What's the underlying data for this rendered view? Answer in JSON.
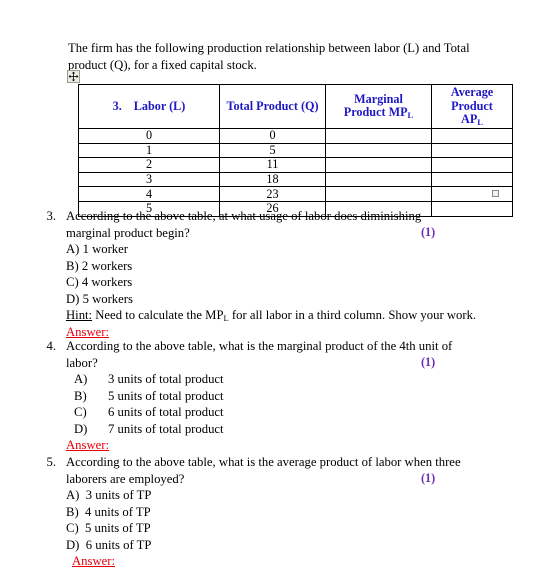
{
  "document": {
    "intro": "The firm has the following production relationship between labor (L) and Total product (Q), for a fixed capital stock."
  },
  "table": {
    "headers": {
      "labor_number": "3.",
      "labor": "Labor (L)",
      "total_product": "Total Product (Q)",
      "marginal_line1": "Marginal",
      "marginal_line2": "Product MP",
      "marginal_sub": "L",
      "average_line1": "Average Product",
      "average_line2": "AP",
      "average_sub": "L"
    },
    "rows": [
      {
        "labor": "0",
        "total_product": "0",
        "marginal_product": "",
        "average_product": ""
      },
      {
        "labor": "1",
        "total_product": "5",
        "marginal_product": "",
        "average_product": ""
      },
      {
        "labor": "2",
        "total_product": "11",
        "marginal_product": "",
        "average_product": ""
      },
      {
        "labor": "3",
        "total_product": "18",
        "marginal_product": "",
        "average_product": ""
      },
      {
        "labor": "4",
        "total_product": "23",
        "marginal_product": "",
        "average_product": ""
      },
      {
        "labor": "5",
        "total_product": "26",
        "marginal_product": "",
        "average_product": ""
      }
    ]
  },
  "questions": [
    {
      "number": "3.",
      "stem": "According to the above table, at what usage of labor does diminishing marginal product begin?",
      "marks": "(1)",
      "options": [
        {
          "label": "A)",
          "text": "1 worker"
        },
        {
          "label": "B)",
          "text": "2 workers"
        },
        {
          "label": "C)",
          "text": "4 workers"
        },
        {
          "label": "D)",
          "text": "5 workers"
        }
      ],
      "hint_label": "Hint:",
      "hint_text": " Need to calculate the MP",
      "hint_sub": "L",
      "hint_text2": " for all labor in a third column. Show your work.",
      "answer_label": "Answer:"
    },
    {
      "number": "4.",
      "stem": "According to the above table, what is the marginal product of the 4th unit of labor?",
      "marks": "(1)",
      "options": [
        {
          "label": "A)",
          "text": "3 units of total product"
        },
        {
          "label": "B)",
          "text": "5 units of total product"
        },
        {
          "label": "C)",
          "text": "6 units of total product"
        },
        {
          "label": "D)",
          "text": "7 units of total product"
        }
      ],
      "answer_label": "Answer:"
    },
    {
      "number": "5.",
      "stem": "According to the above table, what is the average product of labor when three laborers are employed?",
      "marks": "(1)",
      "options": [
        {
          "label": "A)",
          "text": "3 units of TP"
        },
        {
          "label": "B)",
          "text": "4 units of TP"
        },
        {
          "label": "C)",
          "text": "5 units of TP"
        },
        {
          "label": "D)",
          "text": "6 units of TP"
        }
      ],
      "answer_label": "Answer:"
    }
  ],
  "colors": {
    "header_blue": "#1f18c4",
    "marks_purple": "#6c2fb5",
    "answer_red": "#e8000b"
  }
}
